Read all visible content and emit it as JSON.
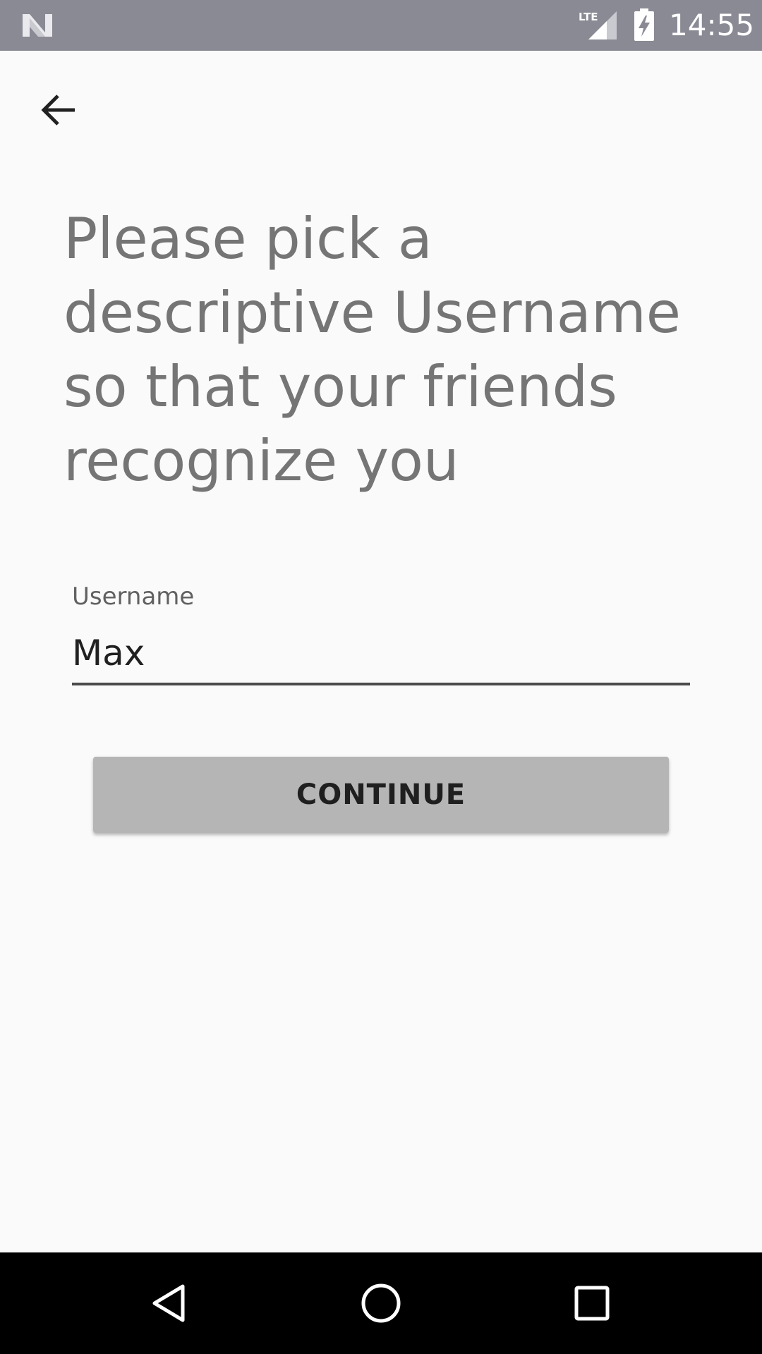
{
  "status_bar": {
    "time": "14:55",
    "network_label": "LTE",
    "icons": [
      "android-n-icon",
      "lte-signal-icon",
      "battery-charging-icon"
    ]
  },
  "toolbar": {
    "back_icon": "arrow-back-icon"
  },
  "headline": "Please pick a descriptive Username so that your friends recognize you",
  "username_field": {
    "label": "Username",
    "value": "Max"
  },
  "continue_button": {
    "label": "CONTINUE"
  },
  "nav_bar": {
    "icons": [
      "nav-back-icon",
      "nav-home-icon",
      "nav-recents-icon"
    ]
  },
  "colors": {
    "status_bar": "#898a94",
    "background": "#fafafa",
    "headline": "#757575",
    "button": "#b5b5b5",
    "nav_bar": "#000000"
  }
}
